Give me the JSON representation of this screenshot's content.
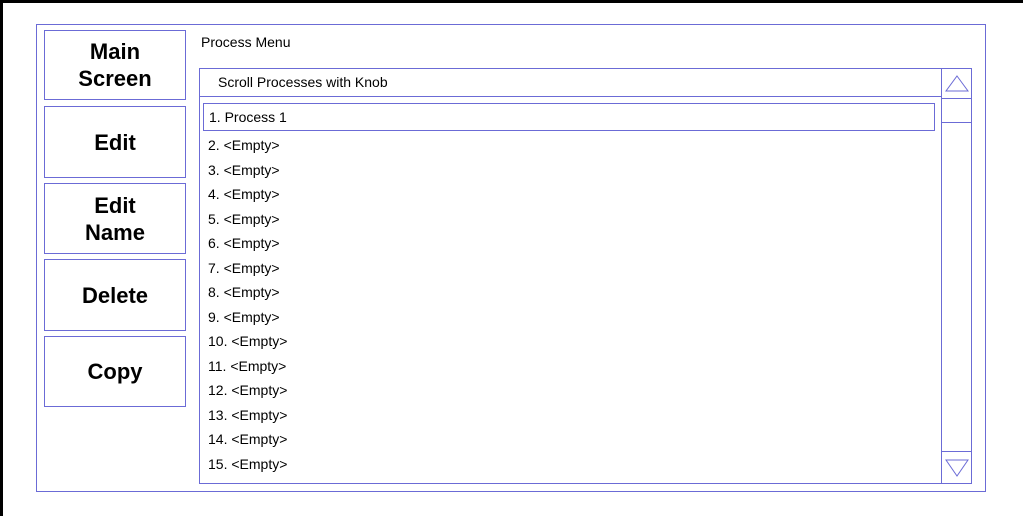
{
  "sidebar": {
    "buttons": [
      {
        "label": "Main\nScreen"
      },
      {
        "label": "Edit"
      },
      {
        "label": "Edit\nName"
      },
      {
        "label": "Delete"
      },
      {
        "label": "Copy"
      }
    ]
  },
  "menu": {
    "title": "Process Menu",
    "list_header": "Scroll Processes with Knob",
    "items": [
      "1. Process 1",
      "2. <Empty>",
      "3. <Empty>",
      "4. <Empty>",
      "5. <Empty>",
      "6. <Empty>",
      "7. <Empty>",
      "8. <Empty>",
      "9. <Empty>",
      "10. <Empty>",
      "11. <Empty>",
      "12. <Empty>",
      "13. <Empty>",
      "14. <Empty>",
      "15. <Empty>"
    ],
    "selected_index": 0
  },
  "icons": {
    "scroll_up": "triangle-up-icon",
    "scroll_down": "triangle-down-icon"
  },
  "colors": {
    "border": "#6b6bd6",
    "frame": "#000000",
    "background": "#ffffff"
  }
}
